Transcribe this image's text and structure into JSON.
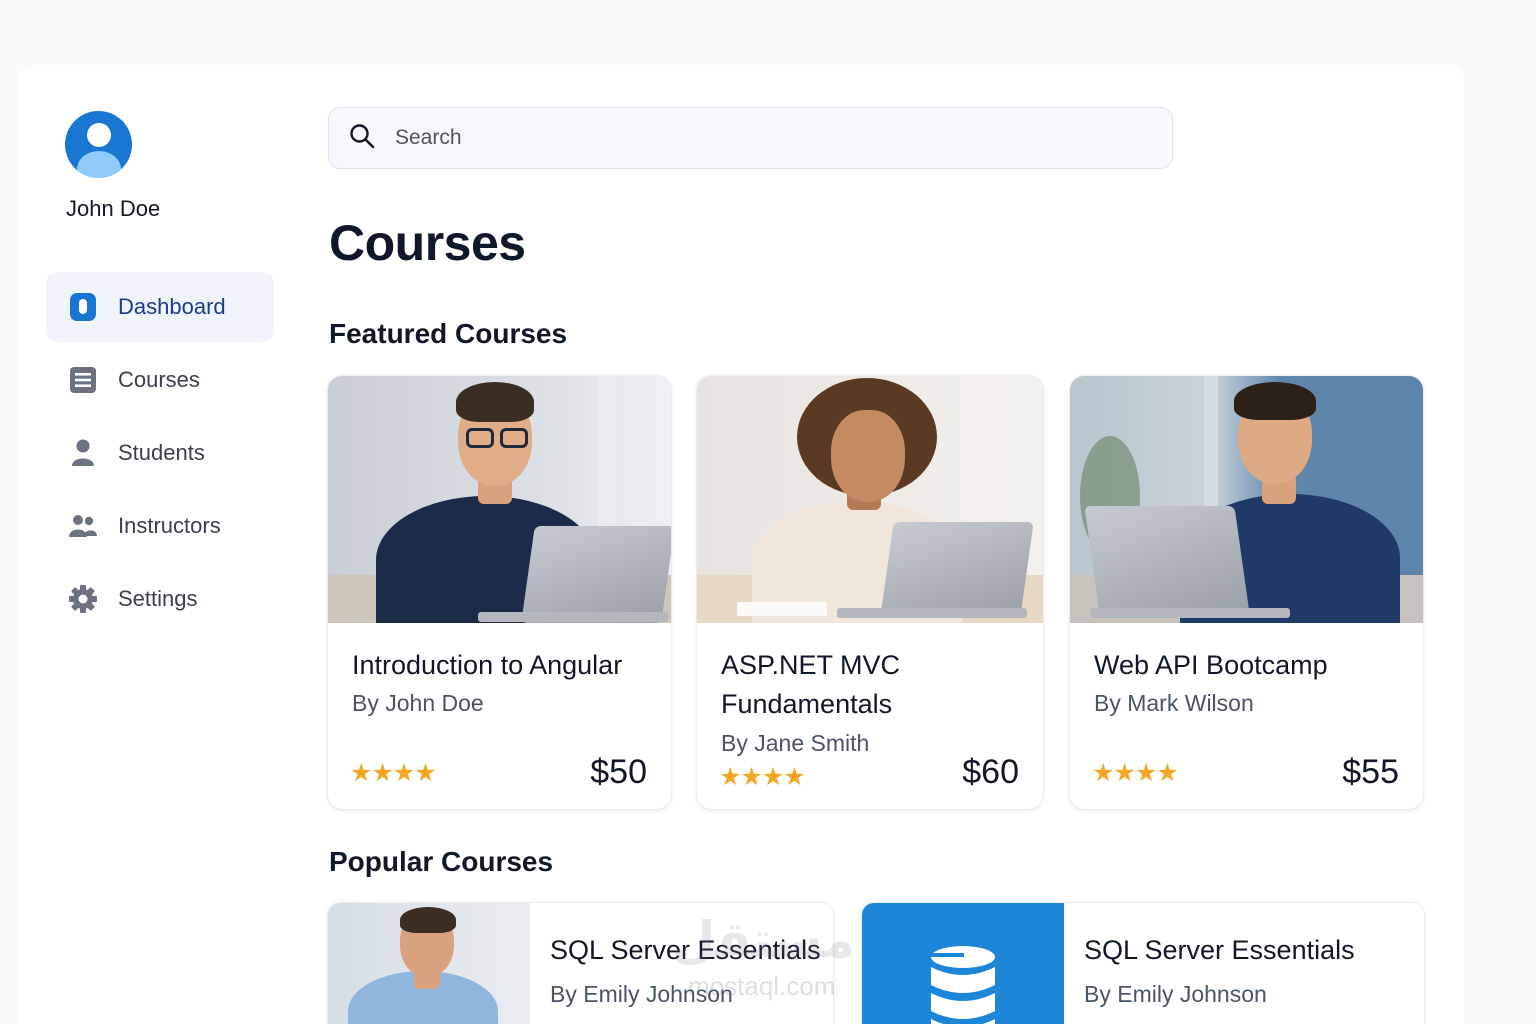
{
  "user": {
    "name": "John Doe"
  },
  "sidebar": {
    "items": [
      {
        "label": "Dashboard",
        "icon": "dashboard-icon",
        "active": true
      },
      {
        "label": "Courses",
        "icon": "courses-icon",
        "active": false
      },
      {
        "label": "Students",
        "icon": "student-icon",
        "active": false
      },
      {
        "label": "Instructors",
        "icon": "instructors-icon",
        "active": false
      },
      {
        "label": "Settings",
        "icon": "gear-icon",
        "active": false
      }
    ]
  },
  "search": {
    "placeholder": "Search",
    "icon": "search-icon"
  },
  "main": {
    "title": "Courses",
    "featured_heading": "Featured Courses",
    "popular_heading": "Popular Courses"
  },
  "featured": [
    {
      "title": "Introduction to Angular",
      "author": "By John Doe",
      "rating": "★★★★",
      "price": "$50"
    },
    {
      "title": "ASP.NET MVC Fundamentals",
      "author": "By Jane Smith",
      "rating": "★★★★",
      "price": "$60"
    },
    {
      "title": "Web API Bootcamp",
      "author": "By Mark Wilson",
      "rating": "★★★★",
      "price": "$55"
    }
  ],
  "popular": [
    {
      "title": "SQL Server Essentials",
      "author": "By Emily Johnson",
      "thumb": "photo"
    },
    {
      "title": "SQL Server Essentials",
      "author": "By Emily Johnson",
      "thumb": "database-icon"
    }
  ],
  "watermark": {
    "arabic": "مستقل",
    "latin": "mostaql.com"
  },
  "colors": {
    "accent": "#1976d2",
    "star": "#f5a623",
    "active_nav_bg": "#eff4fb",
    "page_bg": "#f8fafc"
  }
}
